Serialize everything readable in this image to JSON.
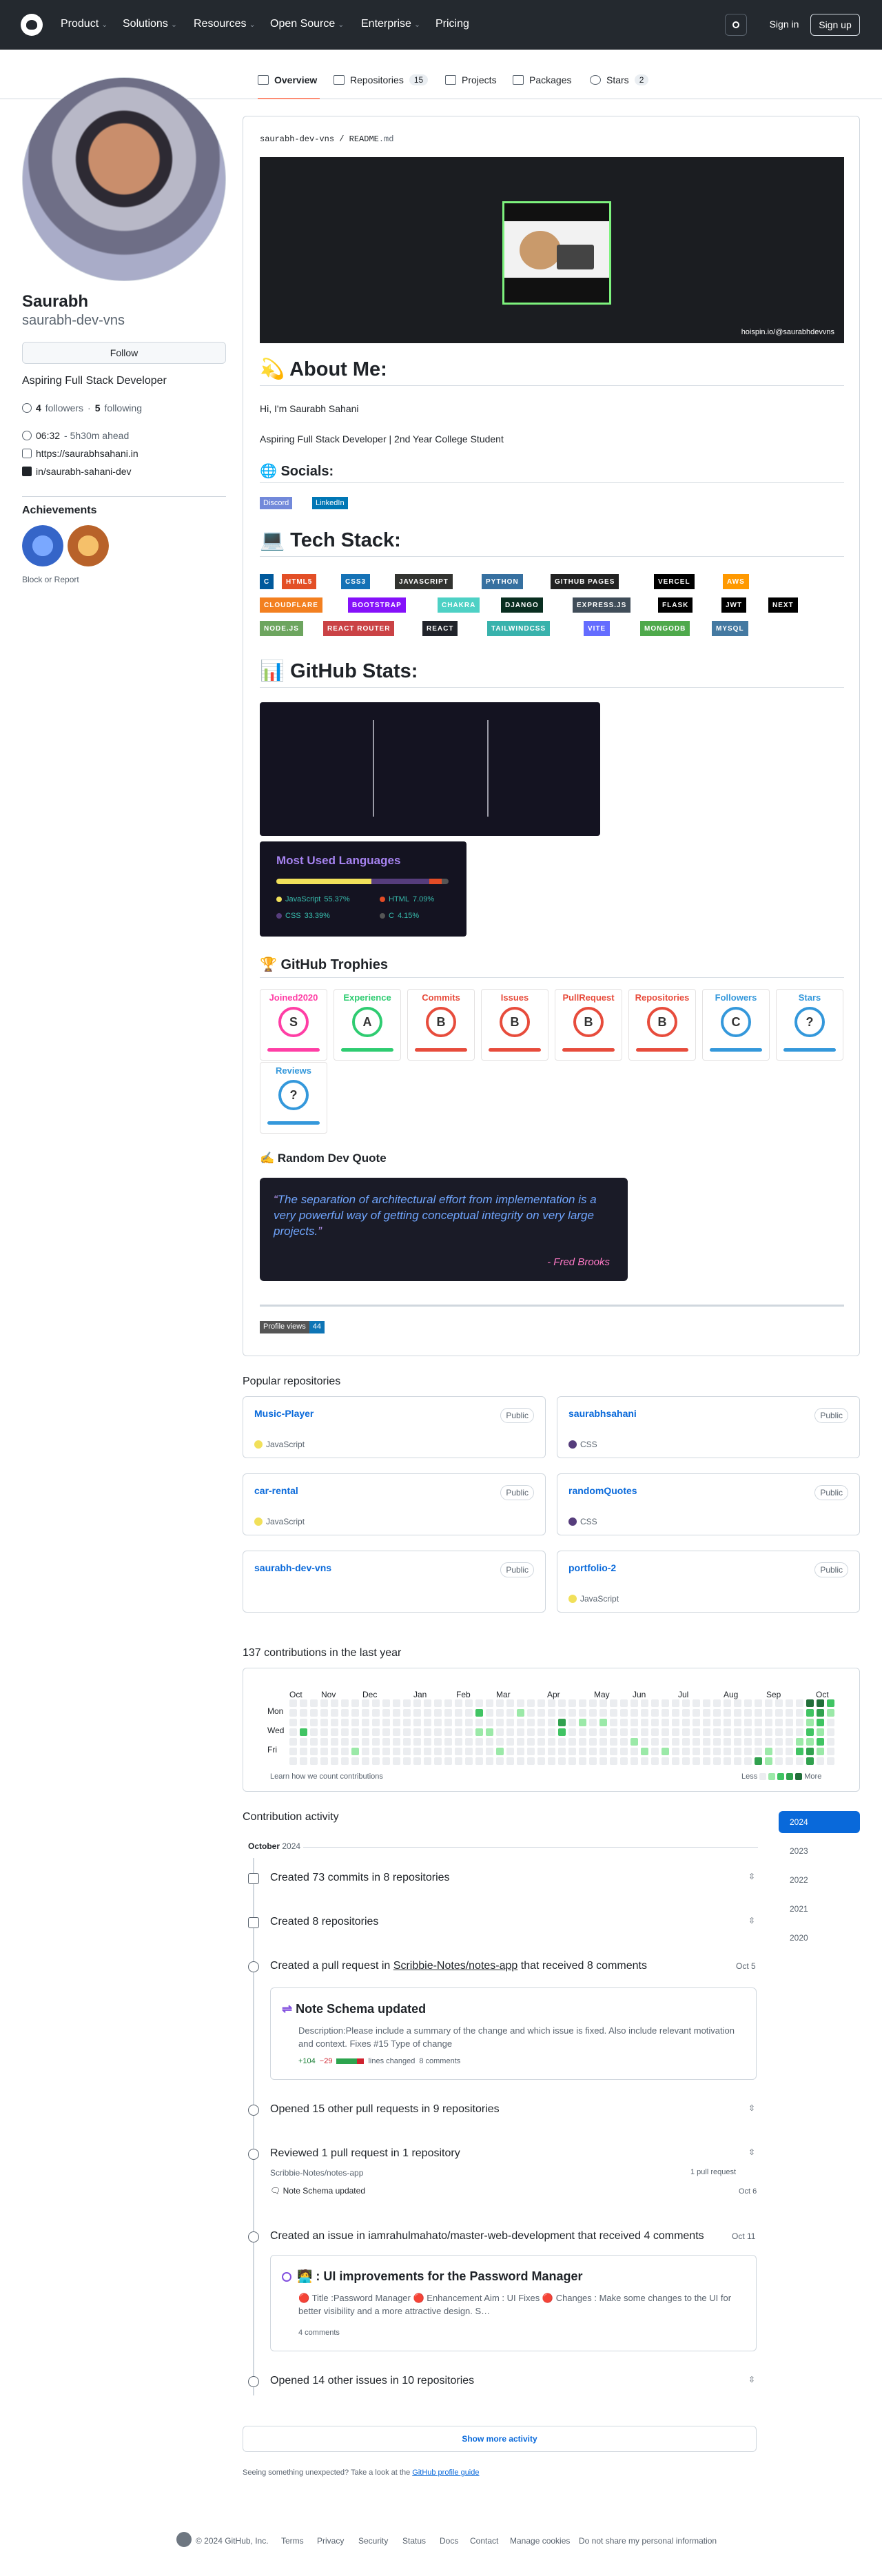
{
  "header": {
    "nav": [
      "Product",
      "Solutions",
      "Resources",
      "Open Source",
      "Enterprise",
      "Pricing"
    ],
    "search_icon": "search-icon",
    "sign_in": "Sign in",
    "sign_up": "Sign up"
  },
  "tabs": [
    {
      "label": "Overview"
    },
    {
      "label": "Repositories",
      "count": "15"
    },
    {
      "label": "Projects"
    },
    {
      "label": "Packages"
    },
    {
      "label": "Stars",
      "count": "2"
    }
  ],
  "profile": {
    "name": "Saurabh",
    "username": "saurabh-dev-vns",
    "follow": "Follow",
    "bio": "Aspiring Full Stack Developer",
    "followers_count": "4",
    "followers_label": "followers",
    "following_count": "5",
    "following_label": "following",
    "time": "06:32",
    "time_offset": "- 5h30m ahead",
    "website": "https://saurabhsahani.in",
    "linkedin": "in/saurabh-sahani-dev",
    "achievements_title": "Achievements",
    "block": "Block or Report"
  },
  "readme": {
    "path_owner": "saurabh-dev-vns",
    "path_sep": "/",
    "path_file": "README",
    "path_ext": ".md",
    "banner_credit": "hoispin.io/@saurabhdevvns",
    "about_title": "About Me:",
    "about_emoji": "💫",
    "greeting": "Hi, I'm Saurabh Sahani",
    "tagline": "Aspiring Full Stack Developer | 2nd Year College Student",
    "socials_title": "Socials:",
    "socials": [
      "Discord",
      "LinkedIn"
    ],
    "tech_title": "Tech Stack:",
    "tech": [
      {
        "label": "C",
        "bg": "#00599C"
      },
      {
        "label": "HTML5",
        "bg": "#E34F26"
      },
      {
        "label": "CSS3",
        "bg": "#1572B6"
      },
      {
        "label": "JAVASCRIPT",
        "bg": "#323330"
      },
      {
        "label": "PYTHON",
        "bg": "#3670A0"
      },
      {
        "label": "GITHUB PAGES",
        "bg": "#222222"
      },
      {
        "label": "VERCEL",
        "bg": "#000000"
      },
      {
        "label": "AWS",
        "bg": "#FF9900"
      },
      {
        "label": "CLOUDFLARE",
        "bg": "#F38020"
      },
      {
        "label": "BOOTSTRAP",
        "bg": "#8511FA"
      },
      {
        "label": "CHAKRA",
        "bg": "#4ED1C5"
      },
      {
        "label": "DJANGO",
        "bg": "#092E20"
      },
      {
        "label": "EXPRESS.JS",
        "bg": "#404D59"
      },
      {
        "label": "FLASK",
        "bg": "#000000"
      },
      {
        "label": "JWT",
        "bg": "#000000"
      },
      {
        "label": "NEXT",
        "bg": "#000000"
      },
      {
        "label": "NODE.JS",
        "bg": "#6DA55F"
      },
      {
        "label": "REACT ROUTER",
        "bg": "#CA4245"
      },
      {
        "label": "REACT",
        "bg": "#20232A"
      },
      {
        "label": "TAILWINDCSS",
        "bg": "#38B2AC"
      },
      {
        "label": "VITE",
        "bg": "#646CFF"
      },
      {
        "label": "MONGODB",
        "bg": "#4EA94B"
      },
      {
        "label": "MYSQL",
        "bg": "#4479A1"
      }
    ],
    "stats_title": "GitHub Stats:",
    "langs_title": "Most Used Languages",
    "langs": [
      {
        "name": "JavaScript",
        "pct": "55.37%",
        "color": "#f1e05a"
      },
      {
        "name": "HTML",
        "pct": "7.09%",
        "color": "#e34c26"
      },
      {
        "name": "CSS",
        "pct": "33.39%",
        "color": "#563d7c"
      },
      {
        "name": "C",
        "pct": "4.15%",
        "color": "#555555"
      }
    ],
    "trophies_title": "GitHub Trophies",
    "trophies": [
      {
        "title": "Joined2020",
        "rank": "S",
        "color": "#ff3ea5"
      },
      {
        "title": "Experience",
        "rank": "A",
        "color": "#2ecc71"
      },
      {
        "title": "Commits",
        "rank": "B",
        "color": "#e74c3c"
      },
      {
        "title": "Issues",
        "rank": "B",
        "color": "#e74c3c"
      },
      {
        "title": "PullRequest",
        "rank": "B",
        "color": "#e74c3c"
      },
      {
        "title": "Repositories",
        "rank": "B",
        "color": "#e74c3c"
      },
      {
        "title": "Followers",
        "rank": "C",
        "color": "#3498db"
      },
      {
        "title": "Stars",
        "rank": "?",
        "color": "#3498db"
      },
      {
        "title": "Reviews",
        "rank": "?",
        "color": "#3498db"
      }
    ],
    "quote_title": "Random Dev Quote",
    "quote_text": "The separation of architectural effort from implementation is a very powerful way of getting conceptual integrity on very large projects.",
    "quote_author": "- Fred Brooks",
    "views_label": "Profile views",
    "views_count": "44"
  },
  "popular": {
    "title": "Popular repositories",
    "repos": [
      {
        "name": "Music-Player",
        "vis": "Public",
        "lang": "JavaScript",
        "color": "#f1e05a"
      },
      {
        "name": "saurabhsahani",
        "vis": "Public",
        "lang": "CSS",
        "color": "#563d7c"
      },
      {
        "name": "car-rental",
        "vis": "Public",
        "lang": "JavaScript",
        "color": "#f1e05a"
      },
      {
        "name": "randomQuotes",
        "vis": "Public",
        "lang": "CSS",
        "color": "#563d7c"
      },
      {
        "name": "saurabh-dev-vns",
        "vis": "Public",
        "lang": "",
        "color": ""
      },
      {
        "name": "portfolio-2",
        "vis": "Public",
        "lang": "JavaScript",
        "color": "#f1e05a"
      }
    ]
  },
  "contrib": {
    "title": "137 contributions in the last year",
    "months": [
      "Oct",
      "Nov",
      "Dec",
      "Jan",
      "Feb",
      "Mar",
      "Apr",
      "May",
      "Jun",
      "Jul",
      "Aug",
      "Sep",
      "Oct"
    ],
    "days": [
      "Mon",
      "Wed",
      "Fri"
    ],
    "learn": "Learn how we count contributions",
    "less": "Less",
    "more": "More",
    "palette": [
      "#ebedf0",
      "#9be9a8",
      "#40c463",
      "#30a14e",
      "#216e39"
    ],
    "active_cells": [
      [
        6,
        5,
        1
      ],
      [
        18,
        1,
        2
      ],
      [
        18,
        3,
        1
      ],
      [
        19,
        3,
        1
      ],
      [
        20,
        5,
        1
      ],
      [
        22,
        1,
        1
      ],
      [
        26,
        2,
        3
      ],
      [
        26,
        3,
        2
      ],
      [
        28,
        2,
        1
      ],
      [
        30,
        2,
        1
      ],
      [
        33,
        4,
        1
      ],
      [
        34,
        5,
        1
      ],
      [
        36,
        5,
        1
      ],
      [
        45,
        6,
        3
      ],
      [
        46,
        5,
        1
      ],
      [
        46,
        6,
        1
      ],
      [
        49,
        4,
        1
      ],
      [
        49,
        5,
        2
      ],
      [
        50,
        0,
        4
      ],
      [
        50,
        1,
        2
      ],
      [
        50,
        2,
        1
      ],
      [
        50,
        3,
        2
      ],
      [
        50,
        4,
        1
      ],
      [
        50,
        5,
        3
      ],
      [
        50,
        6,
        3
      ],
      [
        51,
        0,
        4
      ],
      [
        51,
        1,
        3
      ],
      [
        51,
        2,
        2
      ],
      [
        51,
        3,
        1
      ],
      [
        51,
        4,
        2
      ],
      [
        51,
        5,
        1
      ],
      [
        52,
        0,
        2
      ],
      [
        52,
        1,
        1
      ],
      [
        1,
        3,
        2
      ]
    ]
  },
  "activity": {
    "title": "Contribution activity",
    "month": "October",
    "month_year": "2024",
    "years": [
      "2024",
      "2023",
      "2022",
      "2021",
      "2020"
    ],
    "items": [
      {
        "text": "Created 73 commits in 8 repositories"
      },
      {
        "text": "Created 8 repositories"
      },
      {
        "pre": "Created a pull request in",
        "repo": "Scribbie-Notes/notes-app",
        "post": "that received 8 comments",
        "date": "Oct 5"
      }
    ],
    "pr_title": "Note Schema updated",
    "pr_desc": "Description:Please include a summary of the change and which issue is fixed. Also include relevant motivation and context. Fixes #15 Type of change",
    "pr_add": "+104",
    "pr_del": "−29",
    "pr_lines": "lines changed",
    "pr_comments": "8 comments",
    "opened_prs": "Opened 15 other pull requests in 9 repositories",
    "reviewed": "Reviewed 1 pull request in 1 repository",
    "reviewed_repo": "Scribbie-Notes/notes-app",
    "reviewed_count": "1 pull request",
    "reviewed_pr": "Note Schema updated",
    "reviewed_date": "Oct 6",
    "issue_line": "Created an issue in iamrahulmahato/master-web-development that received 4 comments",
    "issue_date": "Oct 11",
    "issue_title": "🧑‍💻 : UI improvements for the Password Manager",
    "issue_body": "🔴 Title :Password Manager 🔴 Enhancement Aim : UI Fixes 🔴 Changes : Make some changes to the UI for better visibility and a more attractive design. S…",
    "issue_comments": "4 comments",
    "opened_issues": "Opened 14 other issues in 10 repositories",
    "show_more": "Show more activity",
    "unexpected": "Seeing something unexpected? Take a look at the",
    "guide_link": "GitHub profile guide"
  },
  "footer": {
    "copyright": "© 2024 GitHub, Inc.",
    "links": [
      "Terms",
      "Privacy",
      "Security",
      "Status",
      "Docs",
      "Contact",
      "Manage cookies",
      "Do not share my personal information"
    ]
  }
}
